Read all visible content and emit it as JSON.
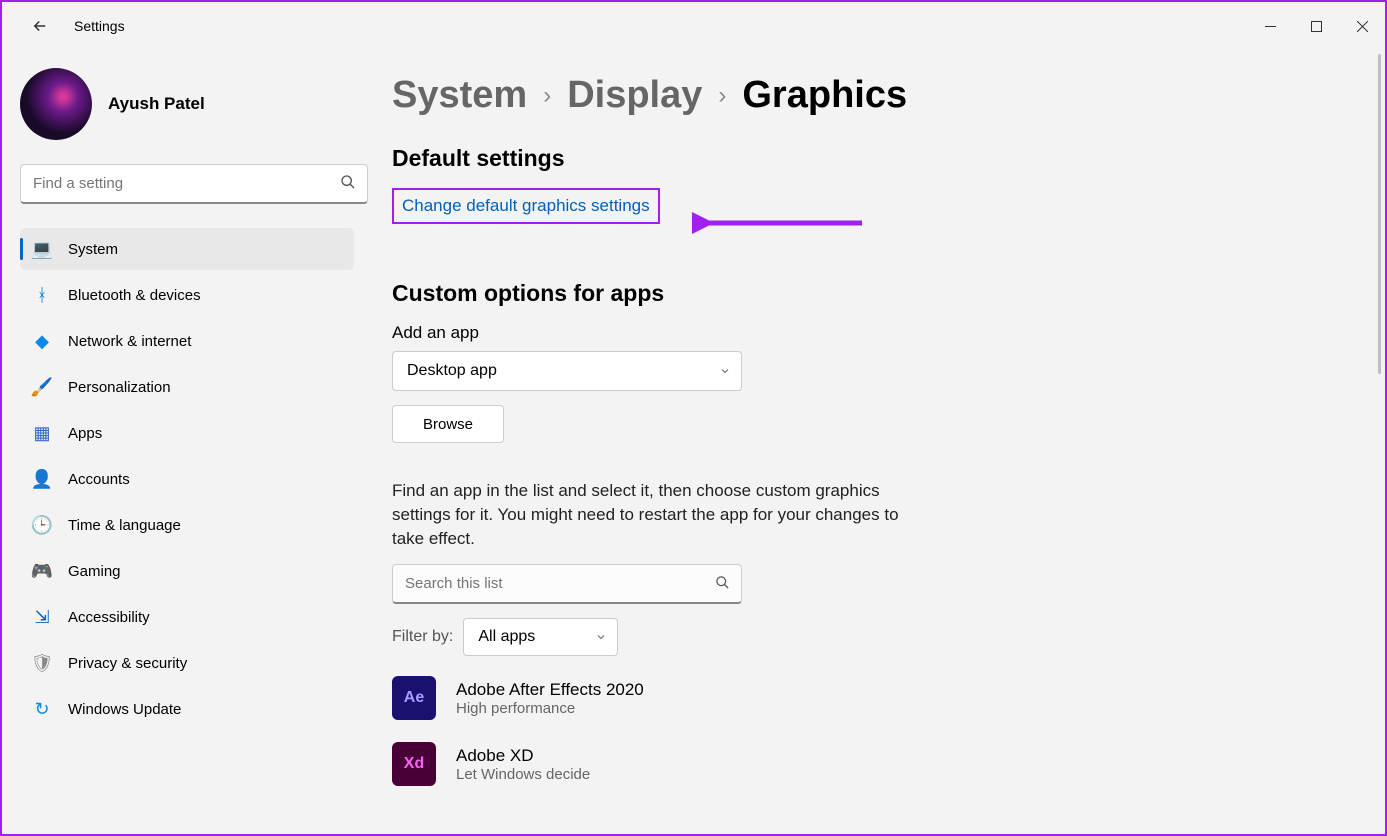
{
  "app_title": "Settings",
  "user": {
    "name": "Ayush Patel"
  },
  "search": {
    "placeholder": "Find a setting"
  },
  "nav": [
    {
      "id": "system",
      "label": "System",
      "icon": "💻",
      "color": "#0078d4",
      "selected": true
    },
    {
      "id": "bluetooth",
      "label": "Bluetooth & devices",
      "icon": "ᚼ",
      "color": "#0078d4"
    },
    {
      "id": "network",
      "label": "Network & internet",
      "icon": "◆",
      "color": "#0a8ae6"
    },
    {
      "id": "personalization",
      "label": "Personalization",
      "icon": "🖌️",
      "color": ""
    },
    {
      "id": "apps",
      "label": "Apps",
      "icon": "▦",
      "color": "#3062c9"
    },
    {
      "id": "accounts",
      "label": "Accounts",
      "icon": "👤",
      "color": "#1eb980"
    },
    {
      "id": "time",
      "label": "Time & language",
      "icon": "🕒",
      "color": "#5a8dee"
    },
    {
      "id": "gaming",
      "label": "Gaming",
      "icon": "🎮",
      "color": "#888"
    },
    {
      "id": "accessibility",
      "label": "Accessibility",
      "icon": "⇲",
      "color": "#0a66c2"
    },
    {
      "id": "privacy",
      "label": "Privacy & security",
      "icon": "🛡",
      "color": "#888"
    },
    {
      "id": "update",
      "label": "Windows Update",
      "icon": "↻",
      "color": "#0a8ae6"
    }
  ],
  "breadcrumb": {
    "parent1": "System",
    "parent2": "Display",
    "current": "Graphics"
  },
  "sections": {
    "default": {
      "title": "Default settings",
      "link": "Change default graphics settings"
    },
    "custom": {
      "title": "Custom options for apps",
      "add_label": "Add an app",
      "app_type_selected": "Desktop app",
      "browse": "Browse",
      "help": "Find an app in the list and select it, then choose custom graphics settings for it. You might need to restart the app for your changes to take effect.",
      "list_search_placeholder": "Search this list",
      "filter_label": "Filter by:",
      "filter_value": "All apps",
      "apps": [
        {
          "name": "Adobe After Effects 2020",
          "setting": "High performance",
          "icon_text": "Ae",
          "bg": "#1a1070",
          "fg": "#a89bff"
        },
        {
          "name": "Adobe XD",
          "setting": "Let Windows decide",
          "icon_text": "Xd",
          "bg": "#470137",
          "fg": "#ff61f6"
        }
      ]
    }
  }
}
